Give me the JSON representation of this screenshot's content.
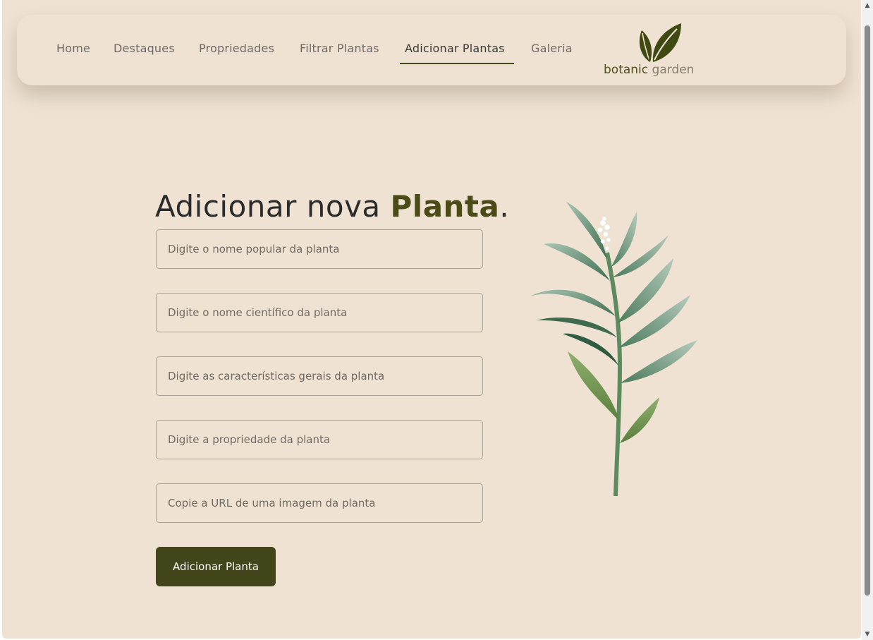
{
  "nav": {
    "items": [
      {
        "label": "Home"
      },
      {
        "label": "Destaques"
      },
      {
        "label": "Propriedades"
      },
      {
        "label": "Filtrar Plantas"
      },
      {
        "label": "Adicionar Plantas",
        "active": true
      },
      {
        "label": "Galeria"
      }
    ]
  },
  "logo": {
    "word1": "botanic",
    "word2": "garden"
  },
  "form": {
    "title_main": "Adicionar nova ",
    "title_accent": "Planta",
    "title_end": ".",
    "fields": [
      {
        "placeholder": "Digite o nome popular da planta"
      },
      {
        "placeholder": "Digite o nome científico da planta"
      },
      {
        "placeholder": "Digite as características gerais da planta"
      },
      {
        "placeholder": "Digite a propriedade da planta"
      },
      {
        "placeholder": "Copie a URL de uma imagem da planta"
      }
    ],
    "submit_label": "Adicionar Planta"
  },
  "icons": {
    "logo": "leaf-pair-icon",
    "illustration": "plant-branch-illustration",
    "scroll_up": "triangle-up-icon",
    "scroll_down": "triangle-down-icon"
  },
  "colors": {
    "background": "#efe2d3",
    "accent": "#4a4b16",
    "button": "#43461a",
    "leaf": "#3f4a12"
  }
}
